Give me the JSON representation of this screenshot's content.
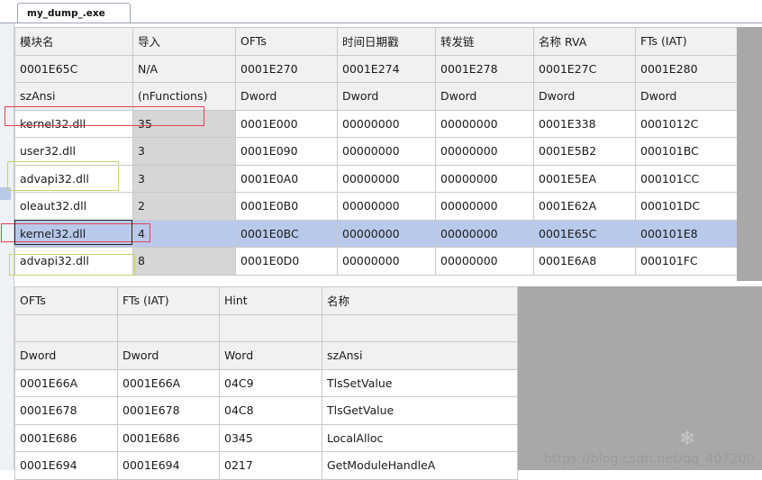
{
  "window": {
    "tab_title": "my_dump_.exe"
  },
  "import_descriptors": {
    "headers": [
      "模块名",
      "导入",
      "OFTs",
      "时间日期戳",
      "转发链",
      "名称 RVA",
      "FTs (IAT)"
    ],
    "offsets": [
      "0001E65C",
      "N/A",
      "0001E270",
      "0001E274",
      "0001E278",
      "0001E27C",
      "0001E280"
    ],
    "types": [
      "szAnsi",
      "(nFunctions)",
      "Dword",
      "Dword",
      "Dword",
      "Dword",
      "Dword"
    ],
    "rows": [
      [
        "kernel32.dll",
        "35",
        "0001E000",
        "00000000",
        "00000000",
        "0001E338",
        "0001012C"
      ],
      [
        "user32.dll",
        "3",
        "0001E090",
        "00000000",
        "00000000",
        "0001E5B2",
        "000101BC"
      ],
      [
        "advapi32.dll",
        "3",
        "0001E0A0",
        "00000000",
        "00000000",
        "0001E5EA",
        "000101CC"
      ],
      [
        "oleaut32.dll",
        "2",
        "0001E0B0",
        "00000000",
        "00000000",
        "0001E62A",
        "000101DC"
      ],
      [
        "kernel32.dll",
        "4",
        "0001E0BC",
        "00000000",
        "00000000",
        "0001E65C",
        "000101E8"
      ],
      [
        "advapi32.dll",
        "8",
        "0001E0D0",
        "00000000",
        "00000000",
        "0001E6A8",
        "000101FC"
      ]
    ]
  },
  "import_functions": {
    "headers": [
      "OFTs",
      "FTs (IAT)",
      "Hint",
      "名称"
    ],
    "offsets": [
      "",
      "",
      "",
      ""
    ],
    "types": [
      "Dword",
      "Dword",
      "Word",
      "szAnsi"
    ],
    "rows": [
      [
        "0001E66A",
        "0001E66A",
        "04C9",
        "TlsSetValue"
      ],
      [
        "0001E678",
        "0001E678",
        "04C8",
        "TlsGetValue"
      ],
      [
        "0001E686",
        "0001E686",
        "0345",
        "LocalAlloc"
      ],
      [
        "0001E694",
        "0001E694",
        "0217",
        "GetModuleHandleA"
      ]
    ]
  },
  "watermark": "https://blog.csdn.net/qq_407200",
  "colors": {
    "selected_row": "#b8c9ec",
    "annotation_red": "#e0454f",
    "annotation_yellow": "#c7d46a",
    "gray_pane": "#a8a8a8"
  }
}
